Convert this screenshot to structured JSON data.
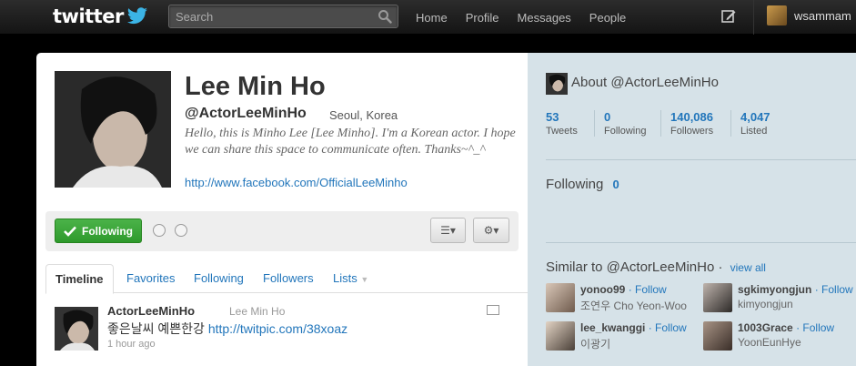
{
  "topbar": {
    "logo_text": "twitter",
    "search_placeholder": "Search",
    "nav": [
      "Home",
      "Profile",
      "Messages",
      "People"
    ],
    "username": "wsammam"
  },
  "profile": {
    "name": "Lee Min Ho",
    "handle": "@ActorLeeMinHo",
    "location": "Seoul, Korea",
    "bio": "Hello, this is Minho Lee [Lee Minho]. I'm a Korean actor. I hope we can share this space to communicate often. Thanks~^_^",
    "url": "http://www.facebook.com/OfficialLeeMinho"
  },
  "actions": {
    "following_label": "Following"
  },
  "tabs": [
    "Timeline",
    "Favorites",
    "Following",
    "Followers",
    "Lists"
  ],
  "tweet": {
    "username": "ActorLeeMinHo",
    "fullname": "Lee Min Ho",
    "text": "좋은날씨 예쁜한강 ",
    "link": "http://twitpic.com/38xoaz",
    "time": "1 hour ago"
  },
  "sidebar": {
    "about_title": "About @ActorLeeMinHo",
    "stats": [
      {
        "num": "53",
        "label": "Tweets"
      },
      {
        "num": "0",
        "label": "Following"
      },
      {
        "num": "140,086",
        "label": "Followers"
      },
      {
        "num": "4,047",
        "label": "Listed"
      }
    ],
    "following_label": "Following",
    "following_count": "0",
    "similar_title": "Similar to @ActorLeeMinHo ·",
    "view_all": "view all",
    "follow_label": "· Follow",
    "similar_users": [
      {
        "screen": "yonoo99",
        "real": "조연우 Cho Yeon-Woo"
      },
      {
        "screen": "sgkimyongjun",
        "real": "kimyongjun"
      },
      {
        "screen": "lee_kwanggi",
        "real": "이광기"
      },
      {
        "screen": "1003Grace",
        "real": "YoonEunHye"
      }
    ]
  },
  "colors": {
    "link": "#2276bb",
    "follow_green": "#3aa736",
    "sidebar_bg": "#d6e2e8"
  }
}
